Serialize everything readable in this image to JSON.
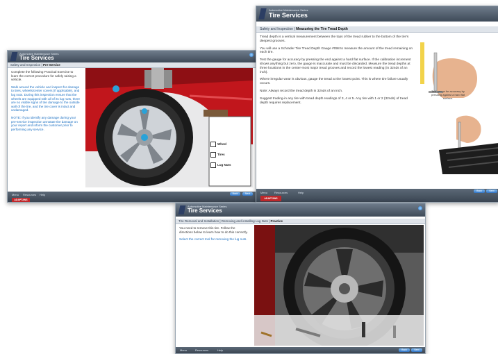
{
  "screens": [
    {
      "series": "Automotive Maintenance Series",
      "course": "Tire Services",
      "breadcrumb_section": "Safety and Inspection",
      "breadcrumb_page": "Pre-Service",
      "paragraphs": [
        "Complete the following Practical Exercise to learn the correct procedure for safely raising a vehicle.",
        "Walk around the vehicle and inspect for damage to tires, wheels/center covers (if applicable), and lug nuts. During this inspection ensure that the wheels are equipped with all of its lug nuts, there are no visible signs of tire damage to the outside wall of the tire, and the tire cover is intact and undamaged.",
        "NOTE: If you identify any damage during your pre-service inspection annotate the damage on your report and inform the customer prior to performing any service."
      ],
      "checklist": [
        "Wheel",
        "Tires",
        "Lug Nuts"
      ],
      "footer_links": [
        "Menu",
        "Resources",
        "Help"
      ],
      "buttons": [
        "Back",
        "Next"
      ],
      "brand": "ADAPTANS"
    },
    {
      "series": "Automotive Maintenance Series",
      "course": "Tire Services",
      "breadcrumb_section": "Safety and Inspection",
      "breadcrumb_page": "Measuring the Tire Tread Depth",
      "paragraphs": [
        "Tread depth is a vertical measurement between the tops of the tread rubber to the bottom of the tire's deepest grooves.",
        "You will use a Schrader Tire Tread Depth Gauge #098 to measure the amount of the tread remaining on each tire.",
        "Test the gauge for accuracy by pressing the end against a hard flat surface. If the calibration increment shows anything but zero, the gauge is inaccurate and must be discarded. Measure the tread depths at three locations in the center-most major tread grooves and record the lowest reading (in 32nds of an inch).",
        "Where irregular wear is obvious, gauge the tread at the lowest point. This is where tire failure usually occurs.",
        "Note: Always record the tread depth in 32nds of an inch.",
        "Suggest trading-in any tire with tread depth readings of 3, 4 or 5. Any tire with 1 or 2 (32nds) of tread depth requires replacement."
      ],
      "caption": "Test gauge for accuracy by pressing against a hard flat surface.",
      "footer_links": [
        "Menu",
        "Resources",
        "Help"
      ],
      "buttons": [
        "Back",
        "Next"
      ],
      "brand": "ADAPTANS"
    },
    {
      "series": "Automotive Maintenance Series",
      "course": "Tire Services",
      "breadcrumb_section": "Tire Removal and Installation",
      "breadcrumb_sub": "Removing and installing Lug Nuts",
      "breadcrumb_page": "Practice",
      "paragraphs": [
        "You need to remove this tire. Follow the directions below to learn how to do this correctly.",
        "Select the correct tool for removing the lug nuts."
      ],
      "footer_links": [
        "Menu",
        "Resources",
        "Help"
      ],
      "buttons": [
        "Back",
        "Next"
      ]
    }
  ]
}
